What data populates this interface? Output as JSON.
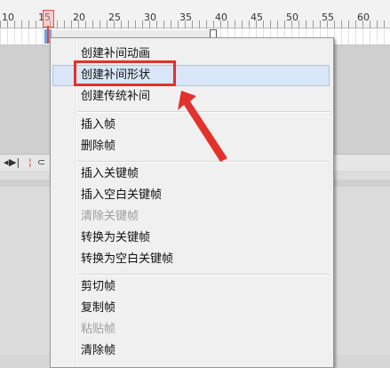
{
  "ruler": {
    "numbers": [
      "10",
      "15",
      "20",
      "25",
      "30",
      "35",
      "40",
      "45",
      "50",
      "55",
      "60"
    ]
  },
  "controls": {
    "next_frame": "▶|",
    "onion_icon": "onion-skin"
  },
  "menu": {
    "items": [
      {
        "label": "创建补间动画",
        "disabled": false
      },
      {
        "label": "创建补间形状",
        "disabled": false,
        "hover": true
      },
      {
        "label": "创建传统补间",
        "disabled": false
      },
      {
        "label": "插入帧",
        "disabled": false
      },
      {
        "label": "删除帧",
        "disabled": false
      },
      {
        "label": "插入关键帧",
        "disabled": false
      },
      {
        "label": "插入空白关键帧",
        "disabled": false
      },
      {
        "label": "清除关键帧",
        "disabled": true
      },
      {
        "label": "转换为关键帧",
        "disabled": false
      },
      {
        "label": "转换为空白关键帧",
        "disabled": false
      },
      {
        "label": "剪切帧",
        "disabled": false
      },
      {
        "label": "复制帧",
        "disabled": false
      },
      {
        "label": "粘贴帧",
        "disabled": true
      },
      {
        "label": "清除帧",
        "disabled": false
      }
    ]
  },
  "annotation": {
    "color": "#e3312b"
  }
}
